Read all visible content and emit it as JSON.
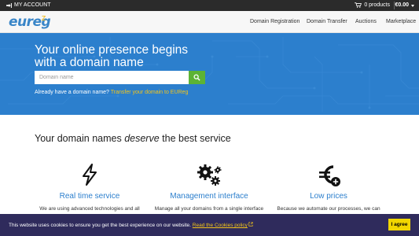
{
  "topbar": {
    "account_label": "MY ACCOUNT",
    "cart_label": "0 products",
    "price_label": "€0.00"
  },
  "nav": {
    "logo": "eureg",
    "items": [
      {
        "label": "Domain Registration"
      },
      {
        "label": "Domain Transfer"
      },
      {
        "label": "Auctions"
      },
      {
        "label": "Marketplace"
      }
    ]
  },
  "hero": {
    "headline": "Your online presence begins with a domain name",
    "search_placeholder": "Domain name",
    "transfer_question": "Already have a domain name?",
    "transfer_link": "Transfer your domain to EUReg"
  },
  "features": {
    "title_before": "Your domain names ",
    "title_emphasis": "deserve",
    "title_after": " the best service",
    "items": [
      {
        "icon": "lightning-icon",
        "title": "Real time service",
        "text": "We are using advanced technologies and all"
      },
      {
        "icon": "gears-icon",
        "title": "Management interface",
        "text": "Manage all your domains from a single interface"
      },
      {
        "icon": "euro-plus-icon",
        "title": "Low prices",
        "text": "Because we automate our processes, we can"
      }
    ]
  },
  "cookie": {
    "message": "This website uses cookies to ensure you get the best experience on our website.",
    "link": "Read the Cookies policy",
    "button": "I agree"
  },
  "colors": {
    "hero_blue": "#2c7fcd",
    "search_green": "#5cb335",
    "link_yellow": "#f5c518",
    "cookie_bg": "#2f2b5c",
    "agree_yellow": "#f1d600"
  }
}
